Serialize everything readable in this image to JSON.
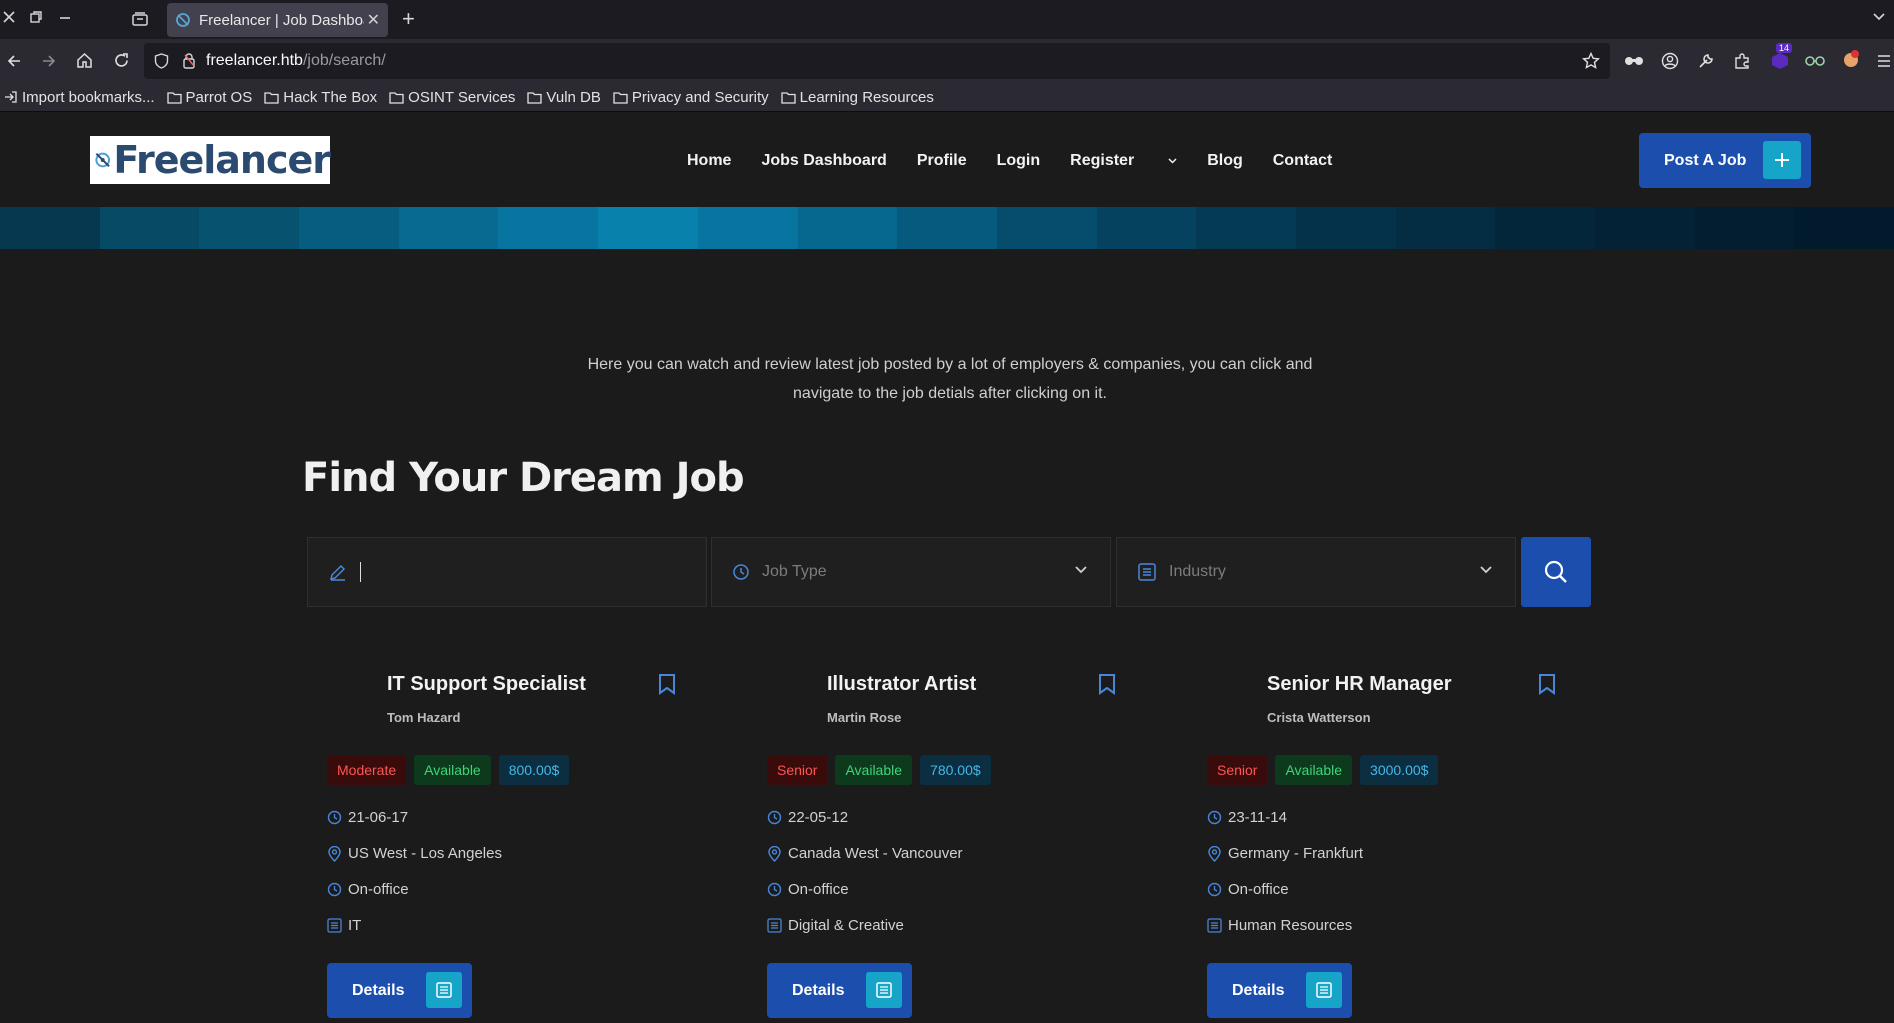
{
  "browser": {
    "tab_title": "Freelancer | Job Dashboard",
    "url_host": "freelancer.htb",
    "url_path": "/job/search/",
    "extension_badge": "14",
    "bookmarks": [
      "Import bookmarks...",
      "Parrot OS",
      "Hack The Box",
      "OSINT Services",
      "Vuln DB",
      "Privacy and Security",
      "Learning Resources"
    ]
  },
  "site": {
    "logo_text": "Freelancer",
    "nav": [
      "Home",
      "Jobs Dashboard",
      "Profile",
      "Login",
      "Register",
      "Blog",
      "Contact"
    ],
    "post_job_label": "Post A Job"
  },
  "intro": {
    "line1": "Here you can watch and review latest job posted by a lot of employers & companies, you can click and",
    "line2": "navigate to the job detials after clicking on it."
  },
  "search": {
    "heading": "Find Your Dream Job",
    "keyword_value": "",
    "job_type_placeholder": "Job Type",
    "industry_placeholder": "Industry"
  },
  "jobs": [
    {
      "title": "IT Support Specialist",
      "company": "Tom Hazard",
      "level": "Moderate",
      "status": "Available",
      "salary": "800.00$",
      "date": "21-06-17",
      "location": "US West - Los Angeles",
      "type": "On-office",
      "industry": "IT",
      "details_label": "Details"
    },
    {
      "title": "Illustrator Artist",
      "company": "Martin Rose",
      "level": "Senior",
      "status": "Available",
      "salary": "780.00$",
      "date": "22-05-12",
      "location": "Canada West - Vancouver",
      "type": "On-office",
      "industry": "Digital & Creative",
      "details_label": "Details"
    },
    {
      "title": "Senior HR Manager",
      "company": "Crista Watterson",
      "level": "Senior",
      "status": "Available",
      "salary": "3000.00$",
      "date": "23-11-14",
      "location": "Germany - Frankfurt",
      "type": "On-office",
      "industry": "Human Resources",
      "details_label": "Details"
    }
  ],
  "colors": {
    "primary": "#1c4fad",
    "accent": "#16a5c9",
    "background": "#1b1b1b"
  }
}
